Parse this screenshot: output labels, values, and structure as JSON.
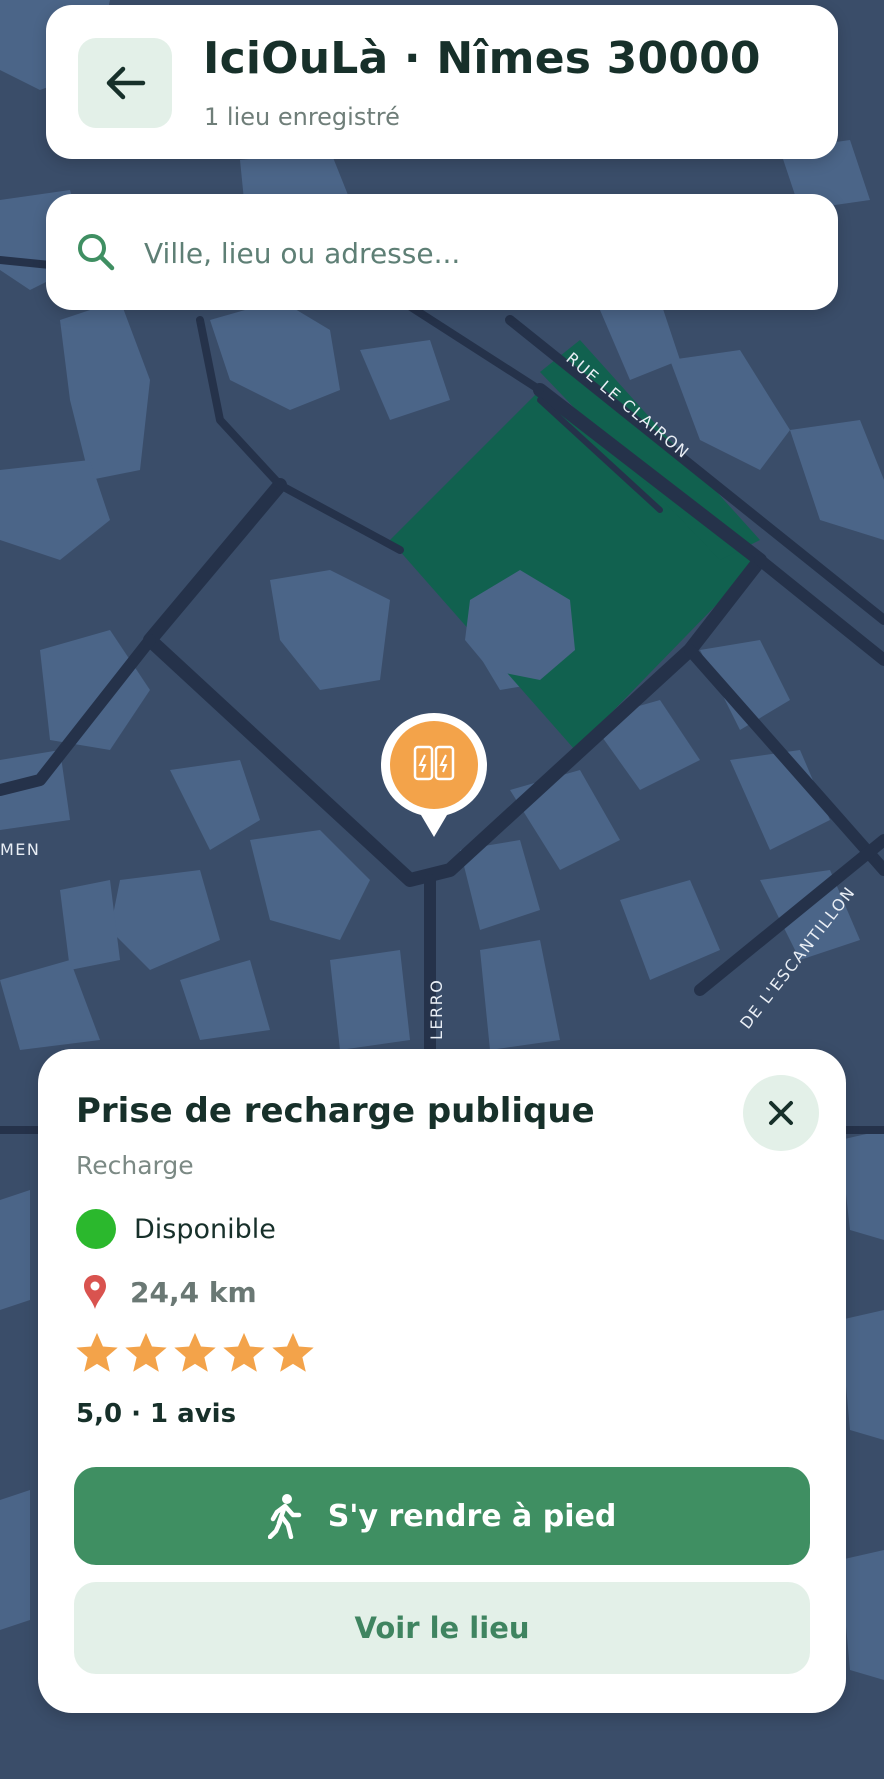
{
  "header": {
    "title": "IciOuLà · Nîmes 30000",
    "subtitle": "1 lieu enregistré",
    "back_icon": "arrow-left-icon"
  },
  "search": {
    "placeholder": "Ville, lieu ou adresse...",
    "value": "",
    "icon": "search-icon"
  },
  "map": {
    "street_labels": [
      "RUE LE CLAIRON",
      "MEN",
      "DE L'ESCANTILLON",
      "LERRO"
    ],
    "marker_icon": "ev-charger-icon",
    "colors": {
      "background": "#3a4d69",
      "buildings": "#4b6588",
      "roads": "#25324a",
      "park": "#11614f",
      "marker": "#f3a34a"
    }
  },
  "place": {
    "title": "Prise de recharge publique",
    "category": "Recharge",
    "status": "Disponible",
    "status_color": "#2bb82d",
    "distance": "24,4 km",
    "rating": 5.0,
    "rating_max": 5,
    "rating_text": "5,0 · 1 avis",
    "star_color": "#f3a34a",
    "walk_button": "S'y rendre à pied",
    "view_button": "Voir le lieu",
    "accent": "#3f8f62"
  }
}
